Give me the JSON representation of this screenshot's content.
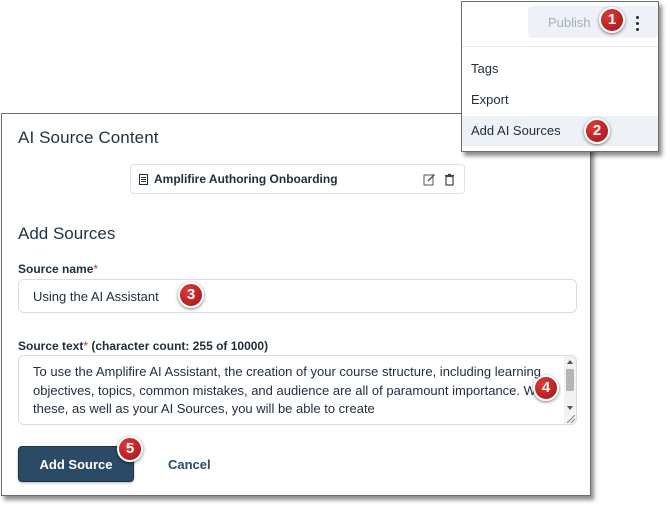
{
  "panel": {
    "title": "AI Source Content",
    "source_card": {
      "name": "Amplifire Authoring Onboarding"
    },
    "section_title": "Add Sources",
    "source_name": {
      "label": "Source name",
      "required_mark": "*",
      "value": "Using the AI Assistant"
    },
    "source_text": {
      "label": "Source text",
      "required_mark": "*",
      "count_text": " (character count: 255 of 10000)",
      "value": "To use the Amplifire AI Assistant, the creation of your course structure, including learning objectives, topics, common mistakes, and audience are all of paramount importance. With these, as well as your AI Sources, you will be able to create"
    },
    "add_button": "Add Source",
    "cancel_button": "Cancel"
  },
  "menu": {
    "publish_label": "Publish",
    "items": [
      {
        "label": "Tags"
      },
      {
        "label": "Export"
      },
      {
        "label": "Add AI Sources"
      }
    ]
  },
  "callouts": [
    "1",
    "2",
    "3",
    "4",
    "5"
  ],
  "colors": {
    "accent": "#2b4a66",
    "callout": "#b51b1b",
    "required": "#c0392b"
  }
}
